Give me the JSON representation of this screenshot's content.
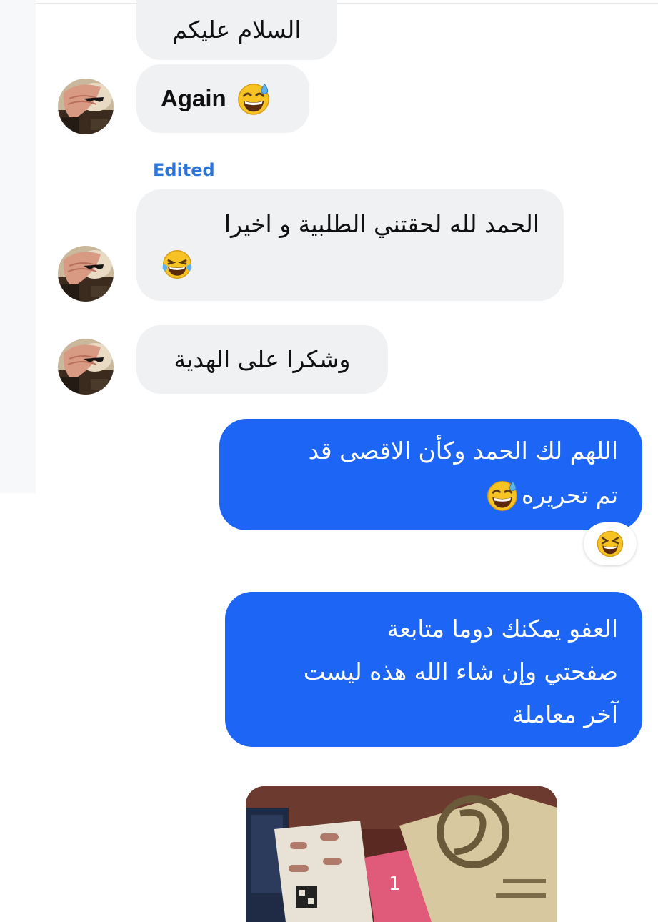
{
  "messages": [
    {
      "text": "السلام عليكم",
      "direction": "incoming"
    },
    {
      "text": "Again",
      "emoji": "grinning-sweat",
      "direction": "incoming"
    },
    {
      "text_line1": "الحمد لله لحقتني الطلبية و اخيرا",
      "emoji": "tears-of-joy",
      "direction": "incoming",
      "label": "Edited"
    },
    {
      "text": "وشكرا على الهدية",
      "direction": "incoming"
    },
    {
      "text_line1": "اللهم لك الحمد وكأن الاقصى قد",
      "text_line2": "تم تحريره",
      "emoji": "grinning-sweat",
      "direction": "outgoing",
      "reaction": "laughing-squint"
    },
    {
      "text_line1": "العفو يمكنك دوما متابعة",
      "text_line2": "صفحتي وإن شاء الله هذه ليست",
      "text_line3": "آخر معاملة",
      "direction": "outgoing"
    }
  ],
  "colors": {
    "outgoing_bubble": "#1d66f5",
    "incoming_bubble": "#f0f1f3",
    "edited_label": "#2c75d8"
  }
}
